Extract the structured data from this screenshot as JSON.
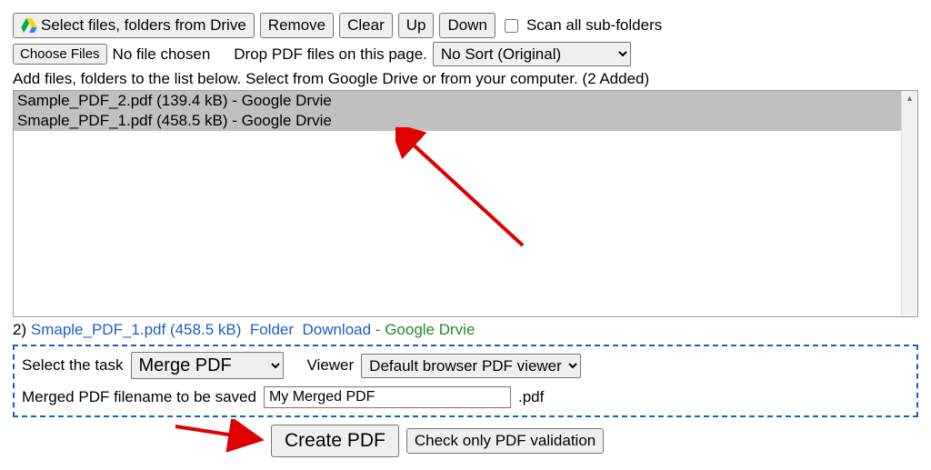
{
  "toolbar1": {
    "drive_button": "Select files, folders from Drive",
    "remove": "Remove",
    "clear": "Clear",
    "up": "Up",
    "down": "Down",
    "scan_label": "Scan all sub-folders"
  },
  "toolbar2": {
    "choose_files": "Choose Files",
    "no_file_chosen": "No file chosen",
    "drop_hint": "Drop PDF files on this page.",
    "sort_selected": "No Sort (Original)"
  },
  "instructions": "Add files, folders to the list below. Select from Google Drive or from your computer. (2 Added)",
  "files": [
    "Sample_PDF_2.pdf (139.4 kB) - Google Drvie",
    "Smaple_PDF_1.pdf (458.5 kB) - Google Drvie"
  ],
  "status": {
    "index": "2)",
    "filename": "Smaple_PDF_1.pdf (458.5 kB)",
    "folder": "Folder",
    "download": "Download",
    "source": "- Google Drvie"
  },
  "task": {
    "label": "Select the task",
    "selected": "Merge PDF",
    "viewer_label": "Viewer",
    "viewer_selected": "Default browser PDF viewer"
  },
  "filename": {
    "label": "Merged PDF filename to be saved",
    "value": "My Merged PDF",
    "ext": ".pdf"
  },
  "actions": {
    "create": "Create PDF",
    "validate": "Check only PDF validation"
  }
}
